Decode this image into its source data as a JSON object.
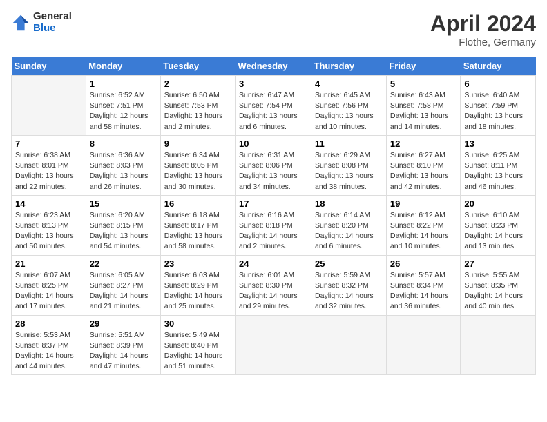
{
  "header": {
    "logo_general": "General",
    "logo_blue": "Blue",
    "month": "April 2024",
    "location": "Flothe, Germany"
  },
  "weekdays": [
    "Sunday",
    "Monday",
    "Tuesday",
    "Wednesday",
    "Thursday",
    "Friday",
    "Saturday"
  ],
  "weeks": [
    [
      {
        "day": "",
        "info": ""
      },
      {
        "day": "1",
        "info": "Sunrise: 6:52 AM\nSunset: 7:51 PM\nDaylight: 12 hours\nand 58 minutes."
      },
      {
        "day": "2",
        "info": "Sunrise: 6:50 AM\nSunset: 7:53 PM\nDaylight: 13 hours\nand 2 minutes."
      },
      {
        "day": "3",
        "info": "Sunrise: 6:47 AM\nSunset: 7:54 PM\nDaylight: 13 hours\nand 6 minutes."
      },
      {
        "day": "4",
        "info": "Sunrise: 6:45 AM\nSunset: 7:56 PM\nDaylight: 13 hours\nand 10 minutes."
      },
      {
        "day": "5",
        "info": "Sunrise: 6:43 AM\nSunset: 7:58 PM\nDaylight: 13 hours\nand 14 minutes."
      },
      {
        "day": "6",
        "info": "Sunrise: 6:40 AM\nSunset: 7:59 PM\nDaylight: 13 hours\nand 18 minutes."
      }
    ],
    [
      {
        "day": "7",
        "info": "Sunrise: 6:38 AM\nSunset: 8:01 PM\nDaylight: 13 hours\nand 22 minutes."
      },
      {
        "day": "8",
        "info": "Sunrise: 6:36 AM\nSunset: 8:03 PM\nDaylight: 13 hours\nand 26 minutes."
      },
      {
        "day": "9",
        "info": "Sunrise: 6:34 AM\nSunset: 8:05 PM\nDaylight: 13 hours\nand 30 minutes."
      },
      {
        "day": "10",
        "info": "Sunrise: 6:31 AM\nSunset: 8:06 PM\nDaylight: 13 hours\nand 34 minutes."
      },
      {
        "day": "11",
        "info": "Sunrise: 6:29 AM\nSunset: 8:08 PM\nDaylight: 13 hours\nand 38 minutes."
      },
      {
        "day": "12",
        "info": "Sunrise: 6:27 AM\nSunset: 8:10 PM\nDaylight: 13 hours\nand 42 minutes."
      },
      {
        "day": "13",
        "info": "Sunrise: 6:25 AM\nSunset: 8:11 PM\nDaylight: 13 hours\nand 46 minutes."
      }
    ],
    [
      {
        "day": "14",
        "info": "Sunrise: 6:23 AM\nSunset: 8:13 PM\nDaylight: 13 hours\nand 50 minutes."
      },
      {
        "day": "15",
        "info": "Sunrise: 6:20 AM\nSunset: 8:15 PM\nDaylight: 13 hours\nand 54 minutes."
      },
      {
        "day": "16",
        "info": "Sunrise: 6:18 AM\nSunset: 8:17 PM\nDaylight: 13 hours\nand 58 minutes."
      },
      {
        "day": "17",
        "info": "Sunrise: 6:16 AM\nSunset: 8:18 PM\nDaylight: 14 hours\nand 2 minutes."
      },
      {
        "day": "18",
        "info": "Sunrise: 6:14 AM\nSunset: 8:20 PM\nDaylight: 14 hours\nand 6 minutes."
      },
      {
        "day": "19",
        "info": "Sunrise: 6:12 AM\nSunset: 8:22 PM\nDaylight: 14 hours\nand 10 minutes."
      },
      {
        "day": "20",
        "info": "Sunrise: 6:10 AM\nSunset: 8:23 PM\nDaylight: 14 hours\nand 13 minutes."
      }
    ],
    [
      {
        "day": "21",
        "info": "Sunrise: 6:07 AM\nSunset: 8:25 PM\nDaylight: 14 hours\nand 17 minutes."
      },
      {
        "day": "22",
        "info": "Sunrise: 6:05 AM\nSunset: 8:27 PM\nDaylight: 14 hours\nand 21 minutes."
      },
      {
        "day": "23",
        "info": "Sunrise: 6:03 AM\nSunset: 8:29 PM\nDaylight: 14 hours\nand 25 minutes."
      },
      {
        "day": "24",
        "info": "Sunrise: 6:01 AM\nSunset: 8:30 PM\nDaylight: 14 hours\nand 29 minutes."
      },
      {
        "day": "25",
        "info": "Sunrise: 5:59 AM\nSunset: 8:32 PM\nDaylight: 14 hours\nand 32 minutes."
      },
      {
        "day": "26",
        "info": "Sunrise: 5:57 AM\nSunset: 8:34 PM\nDaylight: 14 hours\nand 36 minutes."
      },
      {
        "day": "27",
        "info": "Sunrise: 5:55 AM\nSunset: 8:35 PM\nDaylight: 14 hours\nand 40 minutes."
      }
    ],
    [
      {
        "day": "28",
        "info": "Sunrise: 5:53 AM\nSunset: 8:37 PM\nDaylight: 14 hours\nand 44 minutes."
      },
      {
        "day": "29",
        "info": "Sunrise: 5:51 AM\nSunset: 8:39 PM\nDaylight: 14 hours\nand 47 minutes."
      },
      {
        "day": "30",
        "info": "Sunrise: 5:49 AM\nSunset: 8:40 PM\nDaylight: 14 hours\nand 51 minutes."
      },
      {
        "day": "",
        "info": ""
      },
      {
        "day": "",
        "info": ""
      },
      {
        "day": "",
        "info": ""
      },
      {
        "day": "",
        "info": ""
      }
    ]
  ]
}
